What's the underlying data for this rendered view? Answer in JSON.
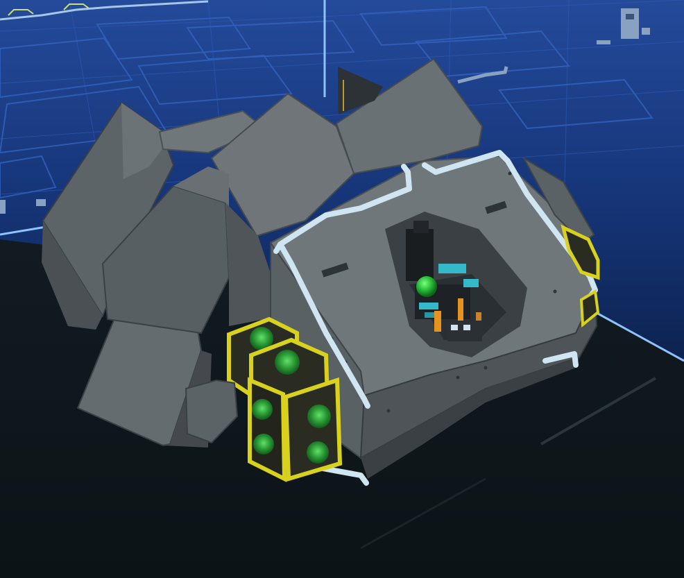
{
  "scene": {
    "colors": {
      "grid_background": "#1a3d8c",
      "grid_line": "#3f74d6",
      "grid_highlight": "#7fb6ff",
      "floor": "#111a1e",
      "hull_light": "#6b7276",
      "hull_mid": "#555c60",
      "hull_dark": "#3f4549",
      "rail": "#cfe6f2",
      "module_frame": "#d8d21e",
      "module_core": "#1f7a2a",
      "module_glow": "#3fbf4a",
      "cockpit_accent": "#35b9c9",
      "cockpit_orange": "#e7931f",
      "indicator_green": "#22b533"
    },
    "objects": {
      "vessel": "pod-vessel",
      "modules": "green-canister-modules",
      "rails": "handrails",
      "cockpit": "open-cockpit",
      "indicator": "green-status-sphere"
    }
  }
}
